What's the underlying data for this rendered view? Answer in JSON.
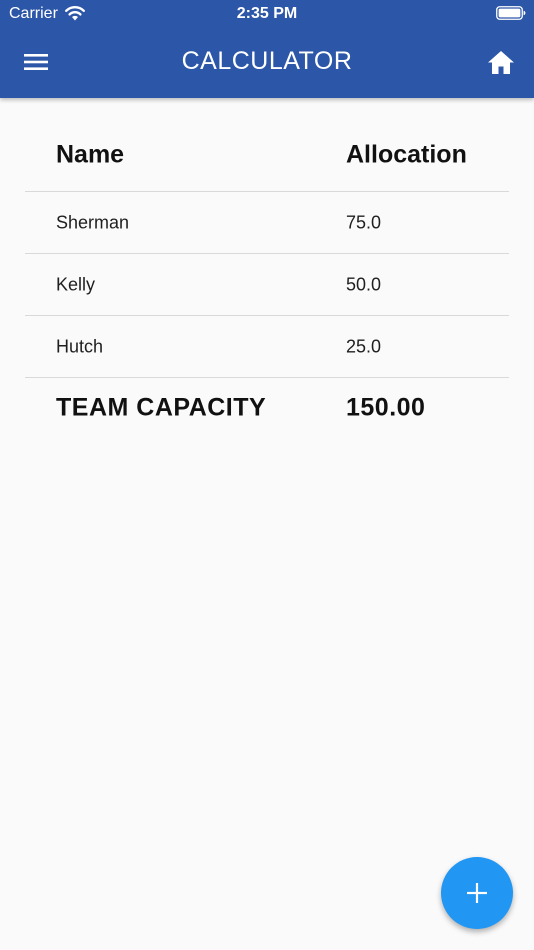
{
  "status_bar": {
    "carrier": "Carrier",
    "time": "2:35 PM",
    "wifi_icon": "wifi-icon",
    "battery_icon": "battery-full-icon"
  },
  "app_bar": {
    "title": "CALCULATOR",
    "menu_icon": "menu-icon",
    "home_icon": "home-icon",
    "color": "#2c56a8"
  },
  "table": {
    "columns": [
      "Name",
      "Allocation"
    ],
    "rows": [
      {
        "name": "Sherman",
        "allocation": "75.0"
      },
      {
        "name": "Kelly",
        "allocation": "50.0"
      },
      {
        "name": "Hutch",
        "allocation": "25.0"
      }
    ],
    "total": {
      "label": "TEAM CAPACITY",
      "value": "150.00"
    }
  },
  "fab": {
    "icon": "plus-icon",
    "color": "#2196f3"
  }
}
